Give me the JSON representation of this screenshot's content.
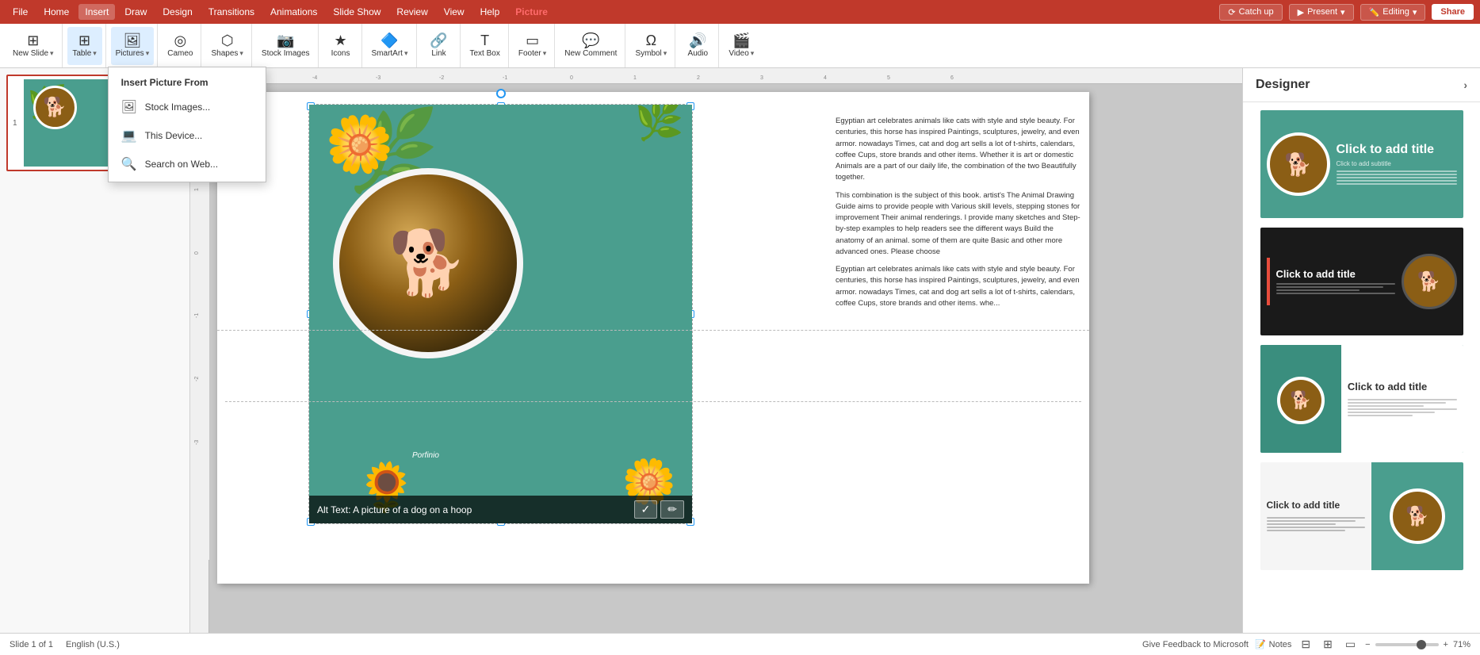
{
  "titlebar": {
    "menu_items": [
      "File",
      "Home",
      "Insert",
      "Draw",
      "Design",
      "Transitions",
      "Animations",
      "Slide Show",
      "Review",
      "View",
      "Help",
      "Picture"
    ],
    "active_menu": "Picture",
    "catch_up_label": "Catch up",
    "present_label": "Present",
    "editing_label": "Editing",
    "share_label": "Share"
  },
  "ribbon": {
    "new_slide_label": "New Slide",
    "table_label": "Table",
    "pictures_label": "Pictures",
    "cameo_label": "Cameo",
    "shapes_label": "Shapes",
    "stock_images_label": "Stock Images",
    "icons_label": "Icons",
    "smart_art_label": "SmartArt",
    "link_label": "Link",
    "text_box_label": "Text Box",
    "footer_label": "Footer",
    "new_comment_label": "New Comment",
    "symbol_label": "Symbol",
    "audio_label": "Audio",
    "video_label": "Video"
  },
  "picture_menu": {
    "header": "Insert Picture From",
    "items": [
      {
        "label": "Stock Images...",
        "icon": "🖼"
      },
      {
        "label": "This Device...",
        "icon": "💻"
      },
      {
        "label": "Search on Web...",
        "icon": "🔍"
      }
    ]
  },
  "slide": {
    "number": "1",
    "text_content": "Egyptian art celebrates animals like cats with style and style beauty. For centuries, this horse has inspired Paintings, sculptures, jewelry, and even armor. nowadays Times, cat and dog art sells a lot of t-shirts, calendars, coffee Cups, store brands and other items. Whether it is art or domestic Animals are a part of our daily life, the combination of the two Beautifully together.\n\nThis combination is the subject of this book. artist's The Animal Drawing Guide aims to provide people with Various skill levels, stepping stones for improvement Their animal renderings. I provide many sketches and Step-by-step examples to help readers see the different ways Build the anatomy of an animal. some of them are quite Basic and other more advanced ones. Please choose\n\nEgyptian art celebrates animals like cats with style and style beauty. For centuries, this horse has inspired Paintings, sculptures, jewelry, and even armor. nowadays Times, cat and dog art sells a lot of t-shirts, calendars, coffee Cups, store brands and other items.",
    "alt_text": "Alt Text: A picture of a dog on a hoop"
  },
  "designer": {
    "title": "Designer",
    "card1": {
      "title": "Click to add title",
      "subtitle": "Click to add subtitle"
    },
    "card2": {
      "title": "Click to add title"
    },
    "card3": {
      "title": "Click to add title"
    },
    "card4": {
      "title": "Click to add title"
    }
  },
  "statusbar": {
    "slide_info": "Slide 1 of 1",
    "language": "English (U.S.)",
    "feedback": "Give Feedback to Microsoft",
    "notes_label": "Notes",
    "zoom_level": "71%"
  }
}
